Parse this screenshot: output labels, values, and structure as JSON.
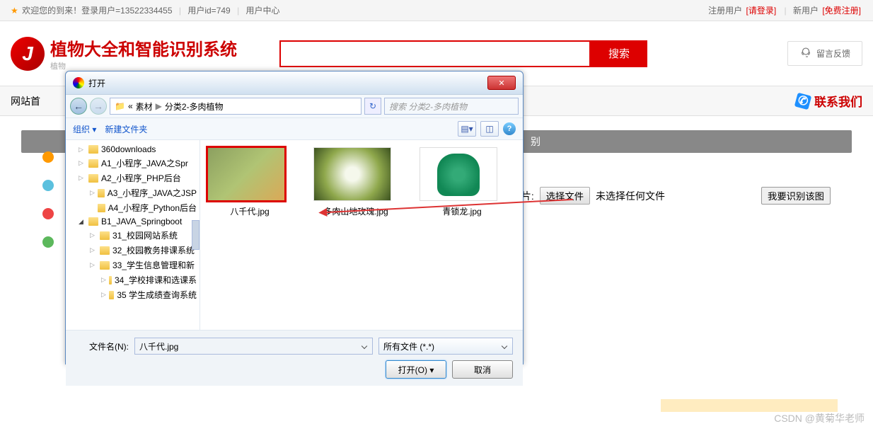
{
  "topbar": {
    "welcome": "欢迎您的到来！登录用户=13522334455",
    "uid": "用户id=749",
    "usercenter": "用户中心",
    "reg_label": "注册用户",
    "login_link": "[请登录]",
    "new_label": "新用户",
    "free_reg": "[免费注册]"
  },
  "header": {
    "title": "植物大全和智能识别系统",
    "sub": "植物",
    "search_btn": "搜索",
    "feedback": "留言反馈"
  },
  "navbar": {
    "left": "网站首",
    "contact": "联系我们"
  },
  "grey_right": "别",
  "form": {
    "pic_label": "图片:",
    "choose_btn": "选择文件",
    "nofile": "未选择任何文件",
    "identify": "我要识别该图"
  },
  "dialog": {
    "title": "打开",
    "path": {
      "a": "素材",
      "b": "分类2-多肉植物"
    },
    "search_placeholder": "搜索 分类2-多肉植物",
    "organize": "组织",
    "newfolder": "新建文件夹",
    "tree": [
      {
        "lvl": 1,
        "exp": "▷",
        "name": "360downloads"
      },
      {
        "lvl": 1,
        "exp": "▷",
        "name": "A1_小程序_JAVA之Spr"
      },
      {
        "lvl": 1,
        "exp": "▷",
        "name": "A2_小程序_PHP后台"
      },
      {
        "lvl": 2,
        "exp": "▷",
        "name": "A3_小程序_JAVA之JSP"
      },
      {
        "lvl": 2,
        "exp": "",
        "name": "A4_小程序_Python后台"
      },
      {
        "lvl": 1,
        "exp": "◢",
        "name": "B1_JAVA_Springboot"
      },
      {
        "lvl": 2,
        "exp": "▷",
        "name": "31_校园网站系统"
      },
      {
        "lvl": 2,
        "exp": "▷",
        "name": "32_校园教务排课系统"
      },
      {
        "lvl": 2,
        "exp": "▷",
        "name": "33_学生信息管理和新"
      },
      {
        "lvl": 3,
        "exp": "▷",
        "name": "34_学校排课和选课系"
      },
      {
        "lvl": 3,
        "exp": "▷",
        "name": "35 学生成绩查询系统"
      }
    ],
    "files": [
      {
        "name": "八千代.jpg",
        "cls": "succ1",
        "sel": true
      },
      {
        "name": "多肉山地玫瑰.jpg",
        "cls": "succ2",
        "sel": false
      },
      {
        "name": "青锁龙.jpg",
        "cls": "succ3",
        "sel": false
      }
    ],
    "filename_label": "文件名(N):",
    "filename": "八千代.jpg",
    "filetype": "所有文件 (*.*)",
    "open_btn": "打开(O)",
    "cancel_btn": "取消"
  },
  "watermark": "CSDN @黄菊华老师"
}
